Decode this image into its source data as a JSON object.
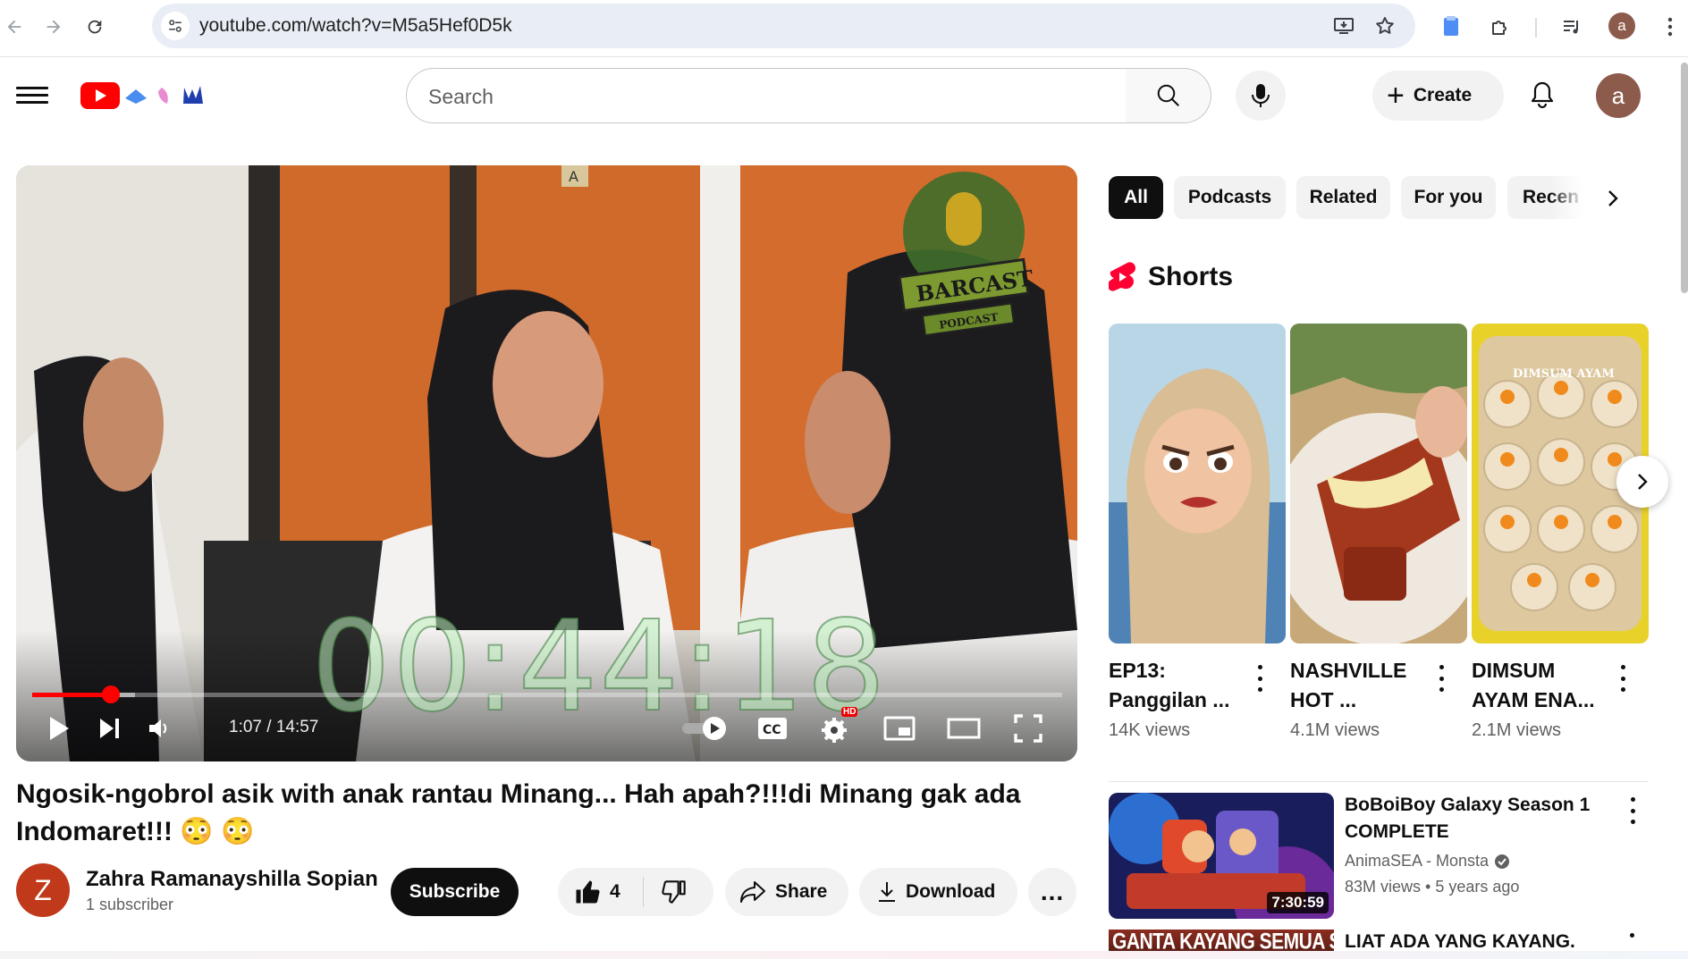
{
  "browser": {
    "url": "youtube.com/watch?v=M5a5Hef0D5k",
    "profile_initial": "a"
  },
  "masthead": {
    "search_placeholder": "Search",
    "create_label": "Create",
    "avatar_initial": "a"
  },
  "player": {
    "overlay_timestamp": "00:44:18",
    "time_display": "1:07 / 14:57",
    "progress_fraction": 0.0765,
    "buffered_fraction": 0.1,
    "hd_badge": "HD",
    "podcast_logo_text": "BARCAST",
    "podcast_logo_sub": "PODCAST",
    "door_letter": "A"
  },
  "video": {
    "title": "Ngosik-ngobrol asik with anak rantau Minang... Hah apah?!!!di Minang gak ada Indomaret!!! 😳 😳",
    "channel_initial": "Z",
    "channel_name": "Zahra Ramanayshilla Sopian",
    "subscribers": "1 subscriber",
    "subscribe_label": "Subscribe",
    "likes": "4",
    "share_label": "Share",
    "download_label": "Download",
    "more_label": "..."
  },
  "chips": [
    {
      "label": "All",
      "active": true
    },
    {
      "label": "Podcasts",
      "active": false
    },
    {
      "label": "Related",
      "active": false
    },
    {
      "label": "For you",
      "active": false
    },
    {
      "label": "Recen",
      "active": false
    }
  ],
  "shorts": {
    "heading": "Shorts",
    "items": [
      {
        "title": "EP13: Panggilan ...",
        "views": "14K views"
      },
      {
        "title": "NASHVILLE HOT ...",
        "views": "4.1M views"
      },
      {
        "title": "DIMSUM AYAM ENA...",
        "views": "2.1M views",
        "thumb_text": "DIMSUM AYAM"
      }
    ]
  },
  "related": [
    {
      "title": "BoBoiBoy Galaxy Season 1 COMPLETE",
      "channel": "AnimaSEA - Monsta",
      "verified": true,
      "views": "83M views",
      "age": "5 years ago",
      "duration": "7:30:59"
    },
    {
      "title": "LIAT ADA YANG KAYANG.",
      "thumb_text": "GANTA KAYANG SEMUA SENANG"
    }
  ],
  "colors": {
    "youtube_red": "#ff0000",
    "chip_bg": "#f2f2f2",
    "text_primary": "#0f0f0f",
    "text_secondary": "#606060"
  }
}
